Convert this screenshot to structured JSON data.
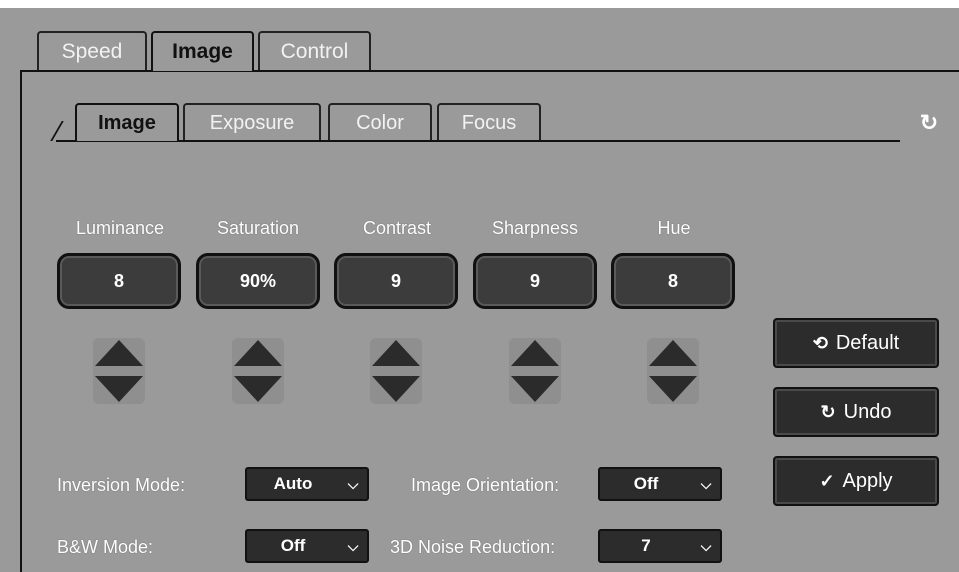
{
  "outer_tabs": [
    {
      "label": "Speed",
      "active": false
    },
    {
      "label": "Image",
      "active": true
    },
    {
      "label": "Control",
      "active": false
    }
  ],
  "inner_tabs": [
    {
      "label": "Image",
      "active": true
    },
    {
      "label": "Exposure",
      "active": false
    },
    {
      "label": "Color",
      "active": false
    },
    {
      "label": "Focus",
      "active": false
    }
  ],
  "refresh_icon": "refresh-icon",
  "params": [
    {
      "label": "Luminance",
      "value": "8"
    },
    {
      "label": "Saturation",
      "value": "90%"
    },
    {
      "label": "Contrast",
      "value": "9"
    },
    {
      "label": "Sharpness",
      "value": "9"
    },
    {
      "label": "Hue",
      "value": "8"
    }
  ],
  "buttons": {
    "default": {
      "label": "Default",
      "icon": "reset-icon"
    },
    "undo": {
      "label": "Undo",
      "icon": "undo-icon"
    },
    "apply": {
      "label": "Apply",
      "icon": "check-circle-icon"
    }
  },
  "settings": {
    "inversion_mode": {
      "label": "Inversion Mode:",
      "value": "Auto"
    },
    "image_orientation": {
      "label": "Image Orientation:",
      "value": "Off"
    },
    "bw_mode": {
      "label": "B&W Mode:",
      "value": "Off"
    },
    "noise_reduction": {
      "label": "3D Noise Reduction:",
      "value": "7"
    }
  },
  "colors": {
    "background": "#9a9a9a",
    "control": "#2c2c2c",
    "text": "#ffffff"
  }
}
